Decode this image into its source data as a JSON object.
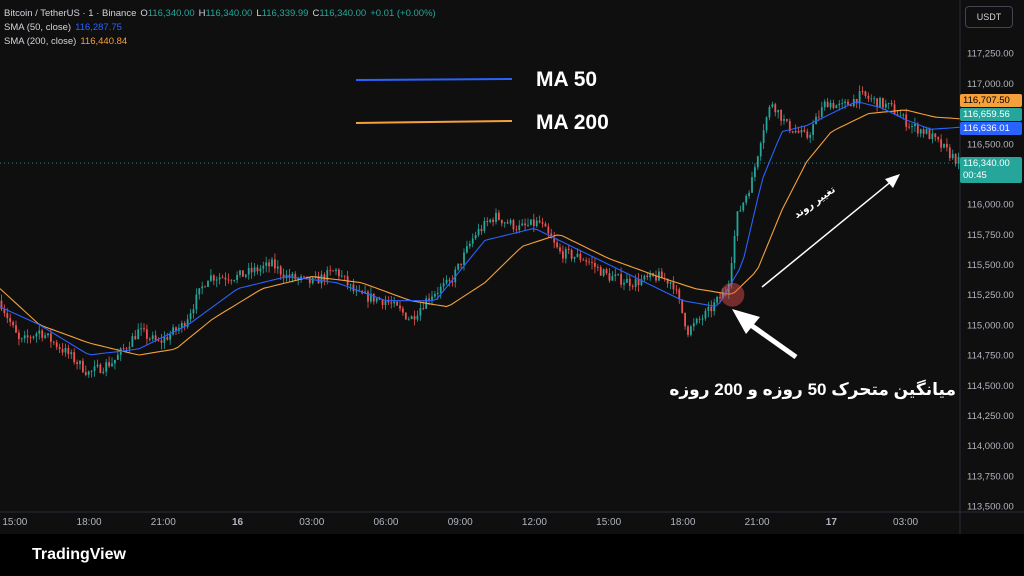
{
  "legend": {
    "symbol": "Bitcoin / TetherUS · 1 · Binance",
    "o_label": "O",
    "o_value": "116,340.00",
    "h_label": "H",
    "h_value": "116,340.00",
    "l_label": "L",
    "l_value": "116,339.99",
    "c_label": "C",
    "c_value": "116,340.00",
    "change": "+0.01 (+0.00%)",
    "sma50_label": "SMA (50, close)",
    "sma50_value": "116,287.75",
    "sma200_label": "SMA (200, close)",
    "sma200_value": "116,440.84"
  },
  "currency": "USDT",
  "annotations": {
    "ma50": "MA 50",
    "ma200": "MA 200",
    "trend_change": "تغییر روند",
    "crossover_note": "میانگین متحرک 50 روزه و 200 روزه"
  },
  "price_tags": {
    "tag_a": "116,707.50",
    "tag_b": "116,659.56",
    "tag_c": "116,636.01",
    "last_price": "116,340.00",
    "countdown": "00:45"
  },
  "footer": {
    "brand": "TradingView"
  },
  "colors": {
    "up": "#26a69a",
    "down": "#ef5350",
    "sma50": "#2962ff",
    "sma200": "#f5a03a",
    "last_price_bg": "#26a69a",
    "tag_a_bg": "#f5a03a",
    "tag_b_bg": "#26a69a",
    "tag_c_bg": "#2962ff"
  },
  "chart_data": {
    "type": "candlestick",
    "title": "Bitcoin / TetherUS · 1 · Binance",
    "ylim": [
      113500,
      117500
    ],
    "y_ticks": [
      113500,
      113750,
      114000,
      114250,
      114500,
      114750,
      115000,
      115250,
      115500,
      115750,
      116000,
      116250,
      116500,
      116750,
      117000,
      117250
    ],
    "y_tick_labels": [
      "113,500.00",
      "113,750.00",
      "114,000.00",
      "114,250.00",
      "114,500.00",
      "114,750.00",
      "115,000.00",
      "115,250.00",
      "115,500.00",
      "115,750.00",
      "116,000.00",
      "116,250.00",
      "116,500.00",
      "116,750.00",
      "117,000.00",
      "117,250.00"
    ],
    "x_tick_labels": [
      "15:00",
      "18:00",
      "21:00",
      "16",
      "03:00",
      "06:00",
      "09:00",
      "12:00",
      "15:00",
      "18:00",
      "21:00",
      "17",
      "03:00"
    ],
    "x_tick_hours": [
      0,
      3,
      6,
      9,
      12,
      15,
      18,
      21,
      24,
      27,
      30,
      33,
      36
    ],
    "x_range_hours": [
      -0.6,
      38.2
    ],
    "price_anchors": [
      [
        -0.6,
        115200
      ],
      [
        0.2,
        114850
      ],
      [
        1.0,
        114950
      ],
      [
        2.2,
        114750
      ],
      [
        3.0,
        114600
      ],
      [
        4.0,
        114700
      ],
      [
        5.0,
        114950
      ],
      [
        5.8,
        114850
      ],
      [
        6.8,
        115000
      ],
      [
        7.8,
        115400
      ],
      [
        9.0,
        115400
      ],
      [
        10.4,
        115500
      ],
      [
        11.0,
        115400
      ],
      [
        12.0,
        115350
      ],
      [
        13.0,
        115450
      ],
      [
        13.8,
        115250
      ],
      [
        15.0,
        115200
      ],
      [
        16.0,
        115050
      ],
      [
        16.8,
        115250
      ],
      [
        17.6,
        115350
      ],
      [
        18.6,
        115750
      ],
      [
        19.4,
        115900
      ],
      [
        20.4,
        115800
      ],
      [
        21.2,
        115850
      ],
      [
        22.0,
        115600
      ],
      [
        23.0,
        115550
      ],
      [
        24.0,
        115400
      ],
      [
        25.0,
        115350
      ],
      [
        26.0,
        115400
      ],
      [
        26.6,
        115350
      ],
      [
        27.2,
        114950
      ],
      [
        28.0,
        115100
      ],
      [
        28.8,
        115300
      ],
      [
        29.2,
        115900
      ],
      [
        29.8,
        116200
      ],
      [
        30.2,
        116600
      ],
      [
        30.6,
        116850
      ],
      [
        31.2,
        116650
      ],
      [
        32.0,
        116550
      ],
      [
        32.8,
        116850
      ],
      [
        33.4,
        116800
      ],
      [
        34.2,
        116900
      ],
      [
        34.8,
        116850
      ],
      [
        35.4,
        116800
      ],
      [
        36.2,
        116650
      ],
      [
        36.8,
        116600
      ],
      [
        37.6,
        116450
      ],
      [
        38.2,
        116340
      ]
    ],
    "sma50_anchors": [
      [
        -0.6,
        115150
      ],
      [
        1.0,
        115000
      ],
      [
        3.0,
        114750
      ],
      [
        5.0,
        114800
      ],
      [
        7.0,
        115000
      ],
      [
        9.0,
        115300
      ],
      [
        11.0,
        115400
      ],
      [
        13.0,
        115350
      ],
      [
        15.0,
        115200
      ],
      [
        17.0,
        115200
      ],
      [
        19.0,
        115700
      ],
      [
        21.0,
        115800
      ],
      [
        23.0,
        115600
      ],
      [
        25.0,
        115400
      ],
      [
        27.0,
        115200
      ],
      [
        28.4,
        115150
      ],
      [
        29.4,
        115500
      ],
      [
        30.2,
        116200
      ],
      [
        31.0,
        116600
      ],
      [
        32.0,
        116650
      ],
      [
        33.0,
        116750
      ],
      [
        34.0,
        116850
      ],
      [
        35.0,
        116800
      ],
      [
        36.0,
        116700
      ],
      [
        37.0,
        116620
      ],
      [
        38.2,
        116636
      ]
    ],
    "sma200_anchors": [
      [
        -0.6,
        115300
      ],
      [
        1.0,
        115000
      ],
      [
        3.0,
        114850
      ],
      [
        5.0,
        114750
      ],
      [
        6.5,
        114800
      ],
      [
        8.0,
        115050
      ],
      [
        10.0,
        115300
      ],
      [
        12.0,
        115400
      ],
      [
        14.0,
        115350
      ],
      [
        16.0,
        115200
      ],
      [
        17.5,
        115150
      ],
      [
        19.0,
        115350
      ],
      [
        20.5,
        115650
      ],
      [
        22.0,
        115750
      ],
      [
        24.0,
        115550
      ],
      [
        26.0,
        115400
      ],
      [
        27.5,
        115300
      ],
      [
        29.0,
        115250
      ],
      [
        30.0,
        115450
      ],
      [
        31.0,
        115950
      ],
      [
        32.0,
        116350
      ],
      [
        33.0,
        116600
      ],
      [
        34.5,
        116750
      ],
      [
        36.0,
        116780
      ],
      [
        37.2,
        116720
      ],
      [
        38.2,
        116707
      ]
    ],
    "last_price": 116340,
    "crossover_point": [
      29.0,
      115250
    ]
  }
}
